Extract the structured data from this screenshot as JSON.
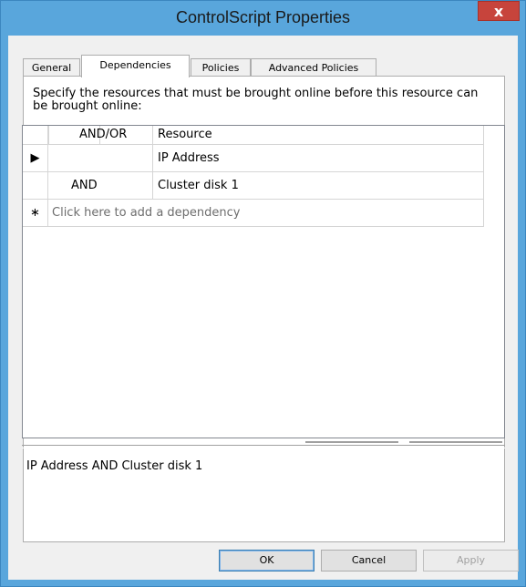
{
  "window": {
    "title": "ControlScript Properties",
    "close_glyph": "x"
  },
  "tabs": [
    {
      "label": "General",
      "active": false
    },
    {
      "label": "Dependencies",
      "active": true
    },
    {
      "label": "Policies",
      "active": false
    },
    {
      "label": "Advanced Policies",
      "active": false
    }
  ],
  "dependencies": {
    "description": "Specify the resources that must be brought online before this resource can be brought online:",
    "columns": {
      "andor": "AND/OR",
      "resource": "Resource"
    },
    "rows": [
      {
        "marker": "▶",
        "andor": "",
        "resource": "IP Address"
      },
      {
        "marker": "",
        "andor": "AND",
        "resource": "Cluster disk 1"
      }
    ],
    "new_row": {
      "marker": "∗",
      "placeholder": "Click here to add a dependency"
    },
    "summary": "IP Address AND Cluster disk 1"
  },
  "buttons": {
    "ok": "OK",
    "cancel": "Cancel",
    "apply": "Apply"
  },
  "colors": {
    "titlebar": "#59a6dc",
    "close": "#c7443c"
  }
}
